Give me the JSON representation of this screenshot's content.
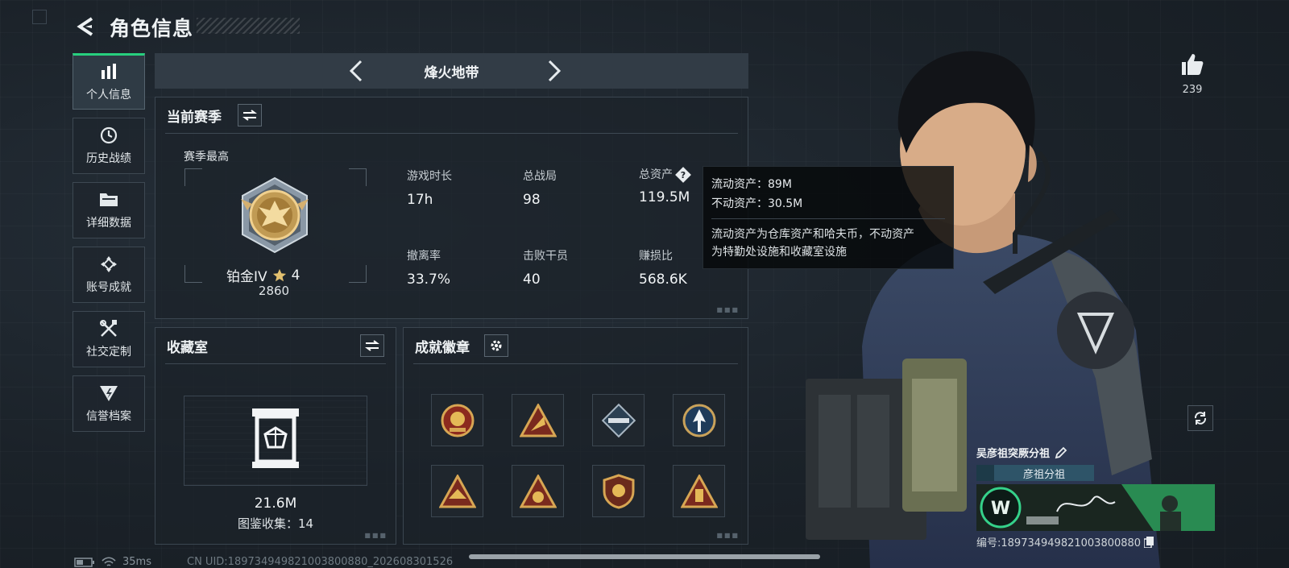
{
  "header": {
    "title": "角色信息"
  },
  "sidebar": {
    "items": [
      {
        "label": "个人信息",
        "icon": "bar-chart-icon",
        "active": true
      },
      {
        "label": "历史战绩",
        "icon": "clock-icon"
      },
      {
        "label": "详细数据",
        "icon": "folder-icon"
      },
      {
        "label": "账号成就",
        "icon": "achievement-icon"
      },
      {
        "label": "社交定制",
        "icon": "tools-icon"
      },
      {
        "label": "信誉档案",
        "icon": "credit-icon"
      }
    ]
  },
  "mode": {
    "name": "烽火地带"
  },
  "season": {
    "heading": "当前赛季",
    "best_label": "赛季最高",
    "rank_name": "铂金IV",
    "rank_stars": "4",
    "rank_score": "2860",
    "stats": [
      {
        "label": "游戏时长",
        "value": "17h"
      },
      {
        "label": "总战局",
        "value": "98"
      },
      {
        "label": "总资产",
        "value": "119.5M"
      },
      {
        "label": "撤离率",
        "value": "33.7%"
      },
      {
        "label": "击败干员",
        "value": "40"
      },
      {
        "label": "赚损比",
        "value": "568.6K"
      }
    ]
  },
  "tooltip": {
    "liquid": "流动资产：89M",
    "fixed": "不动资产：30.5M",
    "line1": "流动资产为仓库资产和哈夫币，不动资产",
    "line2": "为特勤处设施和收藏室设施"
  },
  "collection": {
    "heading": "收藏室",
    "value": "21.6M",
    "count": "图鉴收集：14"
  },
  "badges": {
    "heading": "成就徽章"
  },
  "profile": {
    "likes": "239",
    "name": "吴彦祖突厥分祖",
    "squad": "彦祖分祖",
    "id": "编号:18973494982100380088​0"
  },
  "statusbar": {
    "ping": "35ms",
    "uid": "CN UID:18973494982100380088​0_202608301526"
  },
  "colors": {
    "accent": "#27d07e",
    "squad": "#2e5468"
  }
}
